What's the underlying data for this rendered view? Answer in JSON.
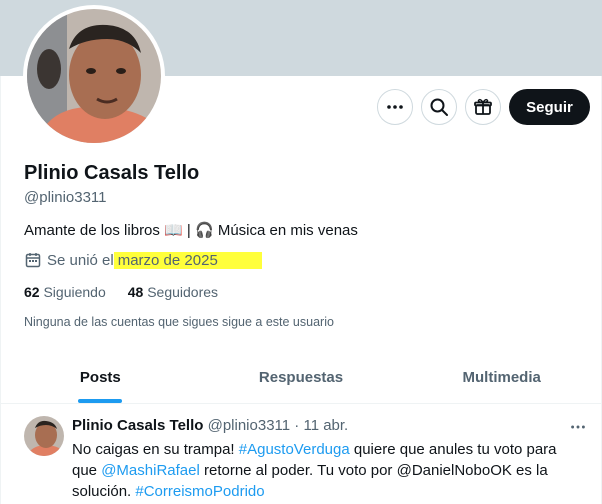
{
  "profile": {
    "name": "Plinio Casals Tello",
    "handle": "@plinio3311",
    "bio": "Amante de los libros 📖 | 🎧 Música en mis venas",
    "joined_prefix": "Se unió el",
    "joined_date": "marzo de 2025",
    "following_count": "62",
    "following_label": "Siguiendo",
    "followers_count": "48",
    "followers_label": "Seguidores",
    "followers_note": "Ninguna de las cuentas que sigues sigue a este usuario"
  },
  "actions": {
    "follow_label": "Seguir",
    "more_icon": "more-icon",
    "search_icon": "search-icon",
    "gift_icon": "gift-icon"
  },
  "tabs": [
    {
      "label": "Posts",
      "active": true
    },
    {
      "label": "Respuestas",
      "active": false
    },
    {
      "label": "Multimedia",
      "active": false
    }
  ],
  "post": {
    "author": "Plinio Casals Tello",
    "handle": "@plinio3311",
    "separator": "·",
    "time": "11 abr.",
    "text_parts": {
      "p1": "No caigas en su trampa! ",
      "hashtag1": "#AgustoVerduga",
      "p2": " quiere que anules tu voto para que ",
      "mention1": "@MashiRafael",
      "p3": " retorne al poder. Tu voto por @DanielNoboOK es la solución. ",
      "hashtag2": "#CorreismoPodrido"
    }
  },
  "colors": {
    "banner": "#cfd9de",
    "accent": "#1d9bf0",
    "highlight": "#ffff3b",
    "text_primary": "#0f1419",
    "text_secondary": "#536471"
  }
}
